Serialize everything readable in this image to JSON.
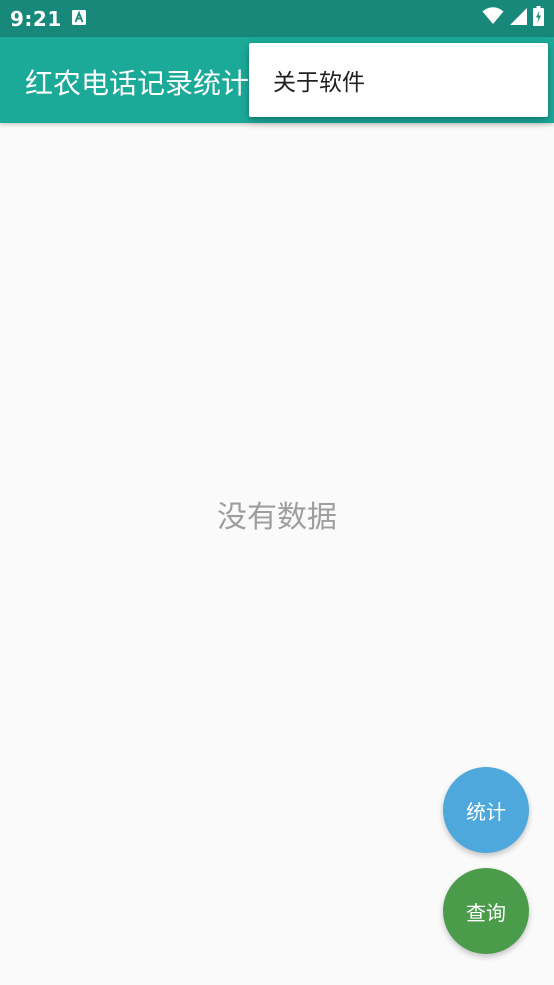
{
  "status_bar": {
    "time": "9:21",
    "notification_icon": "android-a-icon",
    "icons": [
      "wifi-icon",
      "signal-icon",
      "battery-charging-icon"
    ]
  },
  "app_bar": {
    "title": "红农电话记录统计"
  },
  "overflow_menu": {
    "items": [
      {
        "label": "关于软件"
      }
    ]
  },
  "main": {
    "empty_text": "没有数据"
  },
  "fabs": {
    "stats_label": "统计",
    "query_label": "查询"
  },
  "colors": {
    "status_bar": "#17887a",
    "app_bar": "#1ba998",
    "fab_stats": "#4ea8dc",
    "fab_query": "#4a9b4a",
    "empty_text": "#9e9e9e"
  }
}
